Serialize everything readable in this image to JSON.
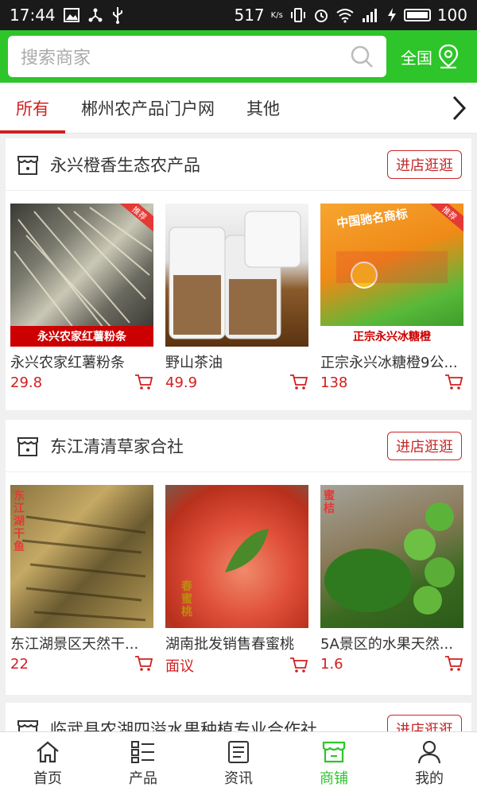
{
  "status_bar": {
    "time": "17:44",
    "network_speed": "517",
    "speed_unit": "K/s",
    "battery": "100"
  },
  "search": {
    "placeholder": "搜索商家",
    "region_label": "全国"
  },
  "tabs": [
    {
      "label": "所有",
      "active": true
    },
    {
      "label": "郴州农产品门户网",
      "active": false
    },
    {
      "label": "其他",
      "active": false
    }
  ],
  "shops": [
    {
      "name": "永兴橙香生态农产品",
      "enter_label": "进店逛逛",
      "products": [
        {
          "name": "永兴农家红薯粉条",
          "price": "29.8",
          "img_caption": "永兴农家红薯粉条",
          "badge": "推荐"
        },
        {
          "name": "野山茶油",
          "price": "49.9"
        },
        {
          "name": "正宗永兴冰糖橙9公...",
          "price": "138",
          "img_caption": "正宗永兴冰糖橙",
          "badge": "推荐",
          "img_top_text": "中国驰名商标"
        }
      ]
    },
    {
      "name": "东江清清草家合社",
      "enter_label": "进店逛逛",
      "products": [
        {
          "name": "东江湖景区天然干...",
          "price": "22",
          "img_vertical_text": "东江湖干鱼"
        },
        {
          "name": "湖南批发销售春蜜桃",
          "price": "面议",
          "img_vertical_text": "春蜜桃"
        },
        {
          "name": "5A景区的水果天然...",
          "price": "1.6",
          "img_vertical_text": "蜜桔"
        }
      ]
    },
    {
      "name": "临武县农湖四溢水果种植专业合作社",
      "enter_label": "进店逛逛"
    }
  ],
  "bottom_nav": [
    {
      "label": "首页",
      "icon": "home-icon"
    },
    {
      "label": "产品",
      "icon": "grid-list-icon"
    },
    {
      "label": "资讯",
      "icon": "news-icon"
    },
    {
      "label": "商铺",
      "icon": "shop-icon",
      "active": true
    },
    {
      "label": "我的",
      "icon": "user-icon"
    }
  ],
  "colors": {
    "brand_green": "#2dc52a",
    "accent_red": "#d02020"
  }
}
